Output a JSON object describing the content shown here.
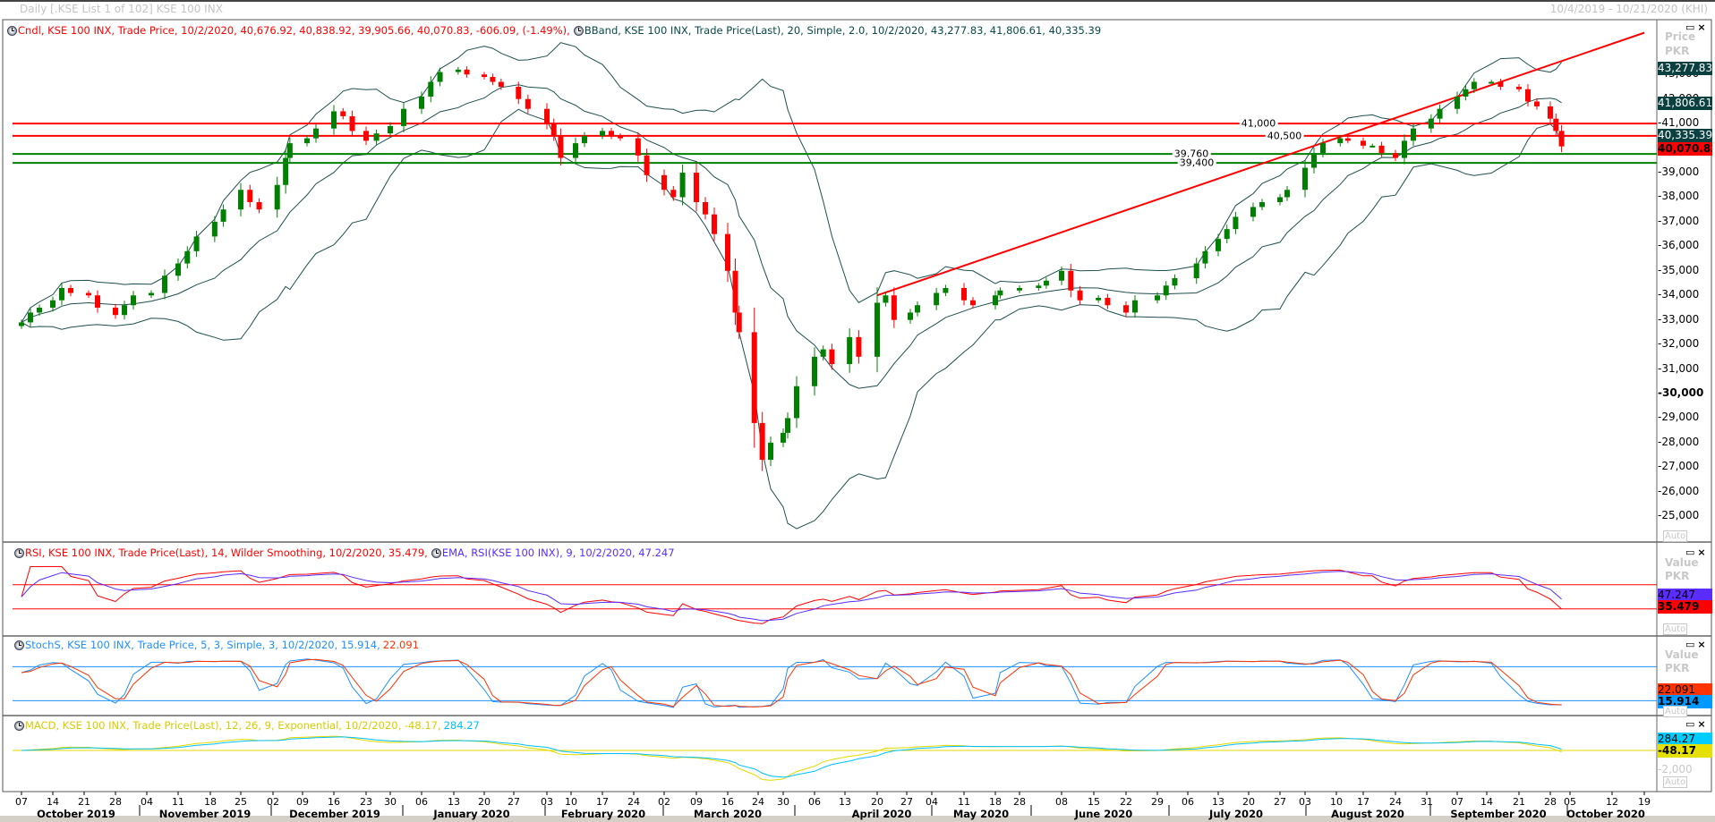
{
  "window": {
    "title": "Daily [.KSE List 1 of 102] KSE 100 INX",
    "range": "10/4/2019 - 10/21/2020 (KHI)",
    "restore_icon": "restore-icon",
    "close_icon": "close-icon"
  },
  "main_panel": {
    "cndl_legend": "Cndl, KSE 100 INX, Trade Price, 10/2/2020, 40,676.92, 40,838.92, 39,905.66, 40,070.83, -606.09, (-1.49%),",
    "bband_legend": "BBand, KSE 100 INX, Trade Price(Last), 20, Simple, 2.0, 10/2/2020, 43,277.83, 41,806.61, 40,335.39",
    "axis_title": "Price",
    "axis_unit": "PKR",
    "auto_label": "Auto",
    "value_boxes": {
      "bb_upper": "43,277.83",
      "bb_mid": "41,806.61",
      "bb_lower": "40,335.39",
      "last": "40,070.83"
    },
    "price_ticks": [
      {
        "v": 43000,
        "label": "-43,000"
      },
      {
        "v": 42000,
        "label": "-42,000"
      },
      {
        "v": 41000,
        "label": "-41,000"
      },
      {
        "v": 39000,
        "label": "-39,000"
      },
      {
        "v": 38000,
        "label": "-38,000"
      },
      {
        "v": 37000,
        "label": "-37,000"
      },
      {
        "v": 36000,
        "label": "-36,000"
      },
      {
        "v": 35000,
        "label": "-35,000"
      },
      {
        "v": 34000,
        "label": "-34,000"
      },
      {
        "v": 33000,
        "label": "-33,000"
      },
      {
        "v": 32000,
        "label": "-32,000"
      },
      {
        "v": 31000,
        "label": "-31,000"
      },
      {
        "v": 30000,
        "label": "-30,000"
      },
      {
        "v": 29000,
        "label": "-29,000"
      },
      {
        "v": 28000,
        "label": "-28,000"
      },
      {
        "v": 27000,
        "label": "-27,000"
      },
      {
        "v": 26000,
        "label": "-26,000"
      },
      {
        "v": 25000,
        "label": "-25,000"
      }
    ],
    "levels": [
      {
        "v": 41000,
        "label": "41,000",
        "color": "#ff0000"
      },
      {
        "v": 40500,
        "label": "40,500",
        "color": "#ff0000"
      },
      {
        "v": 39760,
        "label": "39,760",
        "color": "#008000"
      },
      {
        "v": 39400,
        "label": "39,400",
        "color": "#008000"
      }
    ],
    "trendline": {
      "from": [
        "2020-04-20",
        34000
      ],
      "to": [
        "2020-10-19",
        44700
      ],
      "color": "#ff0000"
    }
  },
  "rsi_panel": {
    "rsi_legend": "RSI, KSE 100 INX, Trade Price(Last),  14, Wilder Smoothing, 10/2/2020, 35.479,",
    "ema_legend": "EMA, RSI(KSE 100 INX),  9, 10/2/2020, 47.247",
    "axis_title": "Value",
    "axis_unit": "PKR",
    "auto_label": "Auto",
    "ema_value": "47.247",
    "rsi_value": "35.479",
    "levels": [
      70,
      30
    ]
  },
  "stoch_panel": {
    "legend_main": "StochS, KSE 100 INX, Trade Price,  5, 3, Simple, 3, 10/2/2020, 15.914,",
    "legend_d": "22.091",
    "axis_title": "Value",
    "axis_unit": "PKR",
    "auto_label": "Auto",
    "d_value": "22.091",
    "k_value": "15.914",
    "levels": [
      80,
      20
    ]
  },
  "macd_panel": {
    "legend_main": "MACD, KSE 100 INX, Trade Price(Last),  12, 26, 9, Exponential, 10/2/2020, -48.17,",
    "legend_signal": "284.27",
    "signal_value": "284.27",
    "macd_value": "-48.17",
    "tick": "-2,000",
    "auto_label": "Auto"
  },
  "colors": {
    "up": "#008000",
    "down": "#ff0000",
    "bband": "#1f4f4f",
    "rsi": "#ff0000",
    "rsi_ema": "#5a2cff",
    "stoch_k": "#1e90ff",
    "stoch_d": "#ff3300",
    "macd": "#e5d800",
    "macd_signal": "#00c0ff"
  },
  "x_axis": {
    "days": [
      {
        "d": "2019-10-07",
        "label": "07"
      },
      {
        "d": "2019-10-14",
        "label": "14"
      },
      {
        "d": "2019-10-21",
        "label": "21"
      },
      {
        "d": "2019-10-28",
        "label": "28"
      },
      {
        "d": "2019-11-04",
        "label": "04"
      },
      {
        "d": "2019-11-11",
        "label": "11"
      },
      {
        "d": "2019-11-18",
        "label": "18"
      },
      {
        "d": "2019-11-25",
        "label": "25"
      },
      {
        "d": "2019-12-02",
        "label": "02"
      },
      {
        "d": "2019-12-09",
        "label": "09"
      },
      {
        "d": "2019-12-16",
        "label": "16"
      },
      {
        "d": "2019-12-23",
        "label": "23"
      },
      {
        "d": "2019-12-30",
        "label": "30"
      },
      {
        "d": "2020-01-06",
        "label": "06"
      },
      {
        "d": "2020-01-13",
        "label": "13"
      },
      {
        "d": "2020-01-20",
        "label": "20"
      },
      {
        "d": "2020-01-27",
        "label": "27"
      },
      {
        "d": "2020-02-03",
        "label": "03"
      },
      {
        "d": "2020-02-10",
        "label": "10"
      },
      {
        "d": "2020-02-17",
        "label": "17"
      },
      {
        "d": "2020-02-24",
        "label": "24"
      },
      {
        "d": "2020-03-02",
        "label": "02"
      },
      {
        "d": "2020-03-09",
        "label": "09"
      },
      {
        "d": "2020-03-16",
        "label": "16"
      },
      {
        "d": "2020-03-24",
        "label": "24"
      },
      {
        "d": "2020-03-30",
        "label": "30"
      },
      {
        "d": "2020-04-06",
        "label": "06"
      },
      {
        "d": "2020-04-13",
        "label": "13"
      },
      {
        "d": "2020-04-20",
        "label": "20"
      },
      {
        "d": "2020-04-27",
        "label": "27"
      },
      {
        "d": "2020-05-04",
        "label": "04"
      },
      {
        "d": "2020-05-11",
        "label": "11"
      },
      {
        "d": "2020-05-18",
        "label": "18"
      },
      {
        "d": "2020-05-28",
        "label": "28"
      },
      {
        "d": "2020-06-08",
        "label": "08"
      },
      {
        "d": "2020-06-15",
        "label": "15"
      },
      {
        "d": "2020-06-22",
        "label": "22"
      },
      {
        "d": "2020-06-29",
        "label": "29"
      },
      {
        "d": "2020-07-06",
        "label": "06"
      },
      {
        "d": "2020-07-13",
        "label": "13"
      },
      {
        "d": "2020-07-20",
        "label": "20"
      },
      {
        "d": "2020-07-27",
        "label": "27"
      },
      {
        "d": "2020-08-03",
        "label": "03"
      },
      {
        "d": "2020-08-10",
        "label": "10"
      },
      {
        "d": "2020-08-17",
        "label": "17"
      },
      {
        "d": "2020-08-24",
        "label": "24"
      },
      {
        "d": "2020-08-31",
        "label": "31"
      },
      {
        "d": "2020-09-07",
        "label": "07"
      },
      {
        "d": "2020-09-14",
        "label": "14"
      },
      {
        "d": "2020-09-21",
        "label": "21"
      },
      {
        "d": "2020-09-28",
        "label": "28"
      },
      {
        "d": "2020-10-05",
        "label": "05"
      },
      {
        "d": "2020-10-12",
        "label": "12"
      },
      {
        "d": "2020-10-19",
        "label": "19"
      }
    ],
    "months": [
      "October 2019",
      "November 2019",
      "December 2019",
      "January 2020",
      "February 2020",
      "March 2020",
      "April 2020",
      "May 2020",
      "June 2020",
      "July 2020",
      "August 2020",
      "September 2020",
      "October 2020"
    ]
  },
  "chart_data": {
    "type": "candlestick",
    "title": "KSE 100 INX Daily",
    "ylabel": "Price PKR",
    "ylim": [
      24500,
      44800
    ],
    "closes": [
      [
        "2019-10-07",
        32900
      ],
      [
        "2019-10-09",
        33300
      ],
      [
        "2019-10-11",
        33500
      ],
      [
        "2019-10-14",
        33800
      ],
      [
        "2019-10-16",
        34300
      ],
      [
        "2019-10-18",
        34100
      ],
      [
        "2019-10-22",
        34000
      ],
      [
        "2019-10-24",
        33500
      ],
      [
        "2019-10-28",
        33200
      ],
      [
        "2019-10-30",
        33600
      ],
      [
        "2019-11-01",
        34000
      ],
      [
        "2019-11-05",
        34100
      ],
      [
        "2019-11-08",
        34800
      ],
      [
        "2019-11-11",
        35300
      ],
      [
        "2019-11-13",
        35800
      ],
      [
        "2019-11-15",
        36400
      ],
      [
        "2019-11-19",
        37000
      ],
      [
        "2019-11-21",
        37500
      ],
      [
        "2019-11-25",
        38300
      ],
      [
        "2019-11-27",
        37800
      ],
      [
        "2019-11-29",
        37500
      ],
      [
        "2019-12-03",
        38500
      ],
      [
        "2019-12-05",
        39600
      ],
      [
        "2019-12-06",
        40200
      ],
      [
        "2019-12-10",
        40400
      ],
      [
        "2019-12-12",
        40800
      ],
      [
        "2019-12-16",
        41500
      ],
      [
        "2019-12-18",
        41300
      ],
      [
        "2019-12-20",
        40700
      ],
      [
        "2019-12-23",
        40300
      ],
      [
        "2019-12-26",
        40600
      ],
      [
        "2019-12-30",
        40900
      ],
      [
        "2020-01-02",
        41600
      ],
      [
        "2020-01-06",
        42100
      ],
      [
        "2020-01-08",
        42700
      ],
      [
        "2020-01-10",
        43100
      ],
      [
        "2020-01-14",
        43200
      ],
      [
        "2020-01-16",
        43000
      ],
      [
        "2020-01-20",
        42900
      ],
      [
        "2020-01-22",
        42700
      ],
      [
        "2020-01-24",
        42500
      ],
      [
        "2020-01-28",
        42000
      ],
      [
        "2020-01-30",
        41600
      ],
      [
        "2020-02-03",
        41000
      ],
      [
        "2020-02-05",
        40500
      ],
      [
        "2020-02-07",
        39600
      ],
      [
        "2020-02-11",
        40200
      ],
      [
        "2020-02-13",
        40500
      ],
      [
        "2020-02-17",
        40700
      ],
      [
        "2020-02-19",
        40500
      ],
      [
        "2020-02-21",
        40400
      ],
      [
        "2020-02-25",
        39700
      ],
      [
        "2020-02-27",
        38900
      ],
      [
        "2020-03-02",
        38300
      ],
      [
        "2020-03-04",
        38000
      ],
      [
        "2020-03-06",
        39000
      ],
      [
        "2020-03-09",
        37800
      ],
      [
        "2020-03-11",
        37300
      ],
      [
        "2020-03-13",
        36500
      ],
      [
        "2020-03-16",
        35000
      ],
      [
        "2020-03-18",
        33300
      ],
      [
        "2020-03-19",
        32500
      ],
      [
        "2020-03-23",
        28800
      ],
      [
        "2020-03-25",
        27300
      ],
      [
        "2020-03-27",
        28000
      ],
      [
        "2020-03-30",
        28400
      ],
      [
        "2020-03-31",
        29000
      ],
      [
        "2020-04-02",
        30300
      ],
      [
        "2020-04-06",
        31500
      ],
      [
        "2020-04-08",
        31800
      ],
      [
        "2020-04-10",
        31200
      ],
      [
        "2020-04-14",
        32300
      ],
      [
        "2020-04-16",
        31500
      ],
      [
        "2020-04-20",
        33700
      ],
      [
        "2020-04-22",
        34000
      ],
      [
        "2020-04-24",
        33000
      ],
      [
        "2020-04-28",
        33300
      ],
      [
        "2020-04-30",
        33600
      ],
      [
        "2020-05-05",
        34100
      ],
      [
        "2020-05-07",
        34300
      ],
      [
        "2020-05-11",
        33800
      ],
      [
        "2020-05-13",
        33600
      ],
      [
        "2020-05-18",
        34000
      ],
      [
        "2020-05-20",
        34200
      ],
      [
        "2020-05-28",
        34300
      ],
      [
        "2020-06-02",
        34400
      ],
      [
        "2020-06-04",
        34600
      ],
      [
        "2020-06-08",
        35000
      ],
      [
        "2020-06-10",
        34200
      ],
      [
        "2020-06-12",
        33800
      ],
      [
        "2020-06-16",
        33900
      ],
      [
        "2020-06-18",
        33600
      ],
      [
        "2020-06-22",
        33300
      ],
      [
        "2020-06-24",
        33800
      ],
      [
        "2020-06-29",
        34000
      ],
      [
        "2020-07-01",
        34400
      ],
      [
        "2020-07-03",
        34700
      ],
      [
        "2020-07-08",
        35300
      ],
      [
        "2020-07-10",
        35800
      ],
      [
        "2020-07-13",
        36300
      ],
      [
        "2020-07-15",
        36700
      ],
      [
        "2020-07-17",
        37200
      ],
      [
        "2020-07-21",
        37600
      ],
      [
        "2020-07-23",
        37800
      ],
      [
        "2020-07-27",
        38000
      ],
      [
        "2020-07-29",
        38300
      ],
      [
        "2020-08-03",
        39200
      ],
      [
        "2020-08-05",
        39800
      ],
      [
        "2020-08-07",
        40200
      ],
      [
        "2020-08-11",
        40400
      ],
      [
        "2020-08-13",
        40300
      ],
      [
        "2020-08-17",
        40100
      ],
      [
        "2020-08-19",
        40100
      ],
      [
        "2020-08-21",
        39800
      ],
      [
        "2020-08-24",
        39600
      ],
      [
        "2020-08-26",
        40300
      ],
      [
        "2020-08-28",
        40800
      ],
      [
        "2020-09-01",
        41200
      ],
      [
        "2020-09-03",
        41600
      ],
      [
        "2020-09-07",
        42100
      ],
      [
        "2020-09-09",
        42400
      ],
      [
        "2020-09-11",
        42700
      ],
      [
        "2020-09-15",
        42700
      ],
      [
        "2020-09-17",
        42500
      ],
      [
        "2020-09-21",
        42400
      ],
      [
        "2020-09-23",
        41900
      ],
      [
        "2020-09-25",
        41700
      ],
      [
        "2020-09-28",
        41200
      ],
      [
        "2020-09-30",
        40700
      ],
      [
        "2020-10-02",
        40070
      ]
    ],
    "last_bar": {
      "date": "10/2/2020",
      "open": 40676.92,
      "high": 40838.92,
      "low": 39905.66,
      "close": 40070.83,
      "change": -606.09,
      "change_pct": -1.49
    },
    "bband": {
      "period": 20,
      "std": 2.0,
      "upper": 43277.83,
      "mid": 41806.61,
      "lower": 40335.39
    },
    "rsi": {
      "period": 14,
      "value": 35.479,
      "ema_period": 9,
      "ema_value": 47.247
    },
    "stoch": {
      "k": 15.914,
      "d": 22.091
    },
    "macd": {
      "fast": 12,
      "slow": 26,
      "signal": 9,
      "macd": -48.17,
      "signal_value": 284.27
    }
  }
}
